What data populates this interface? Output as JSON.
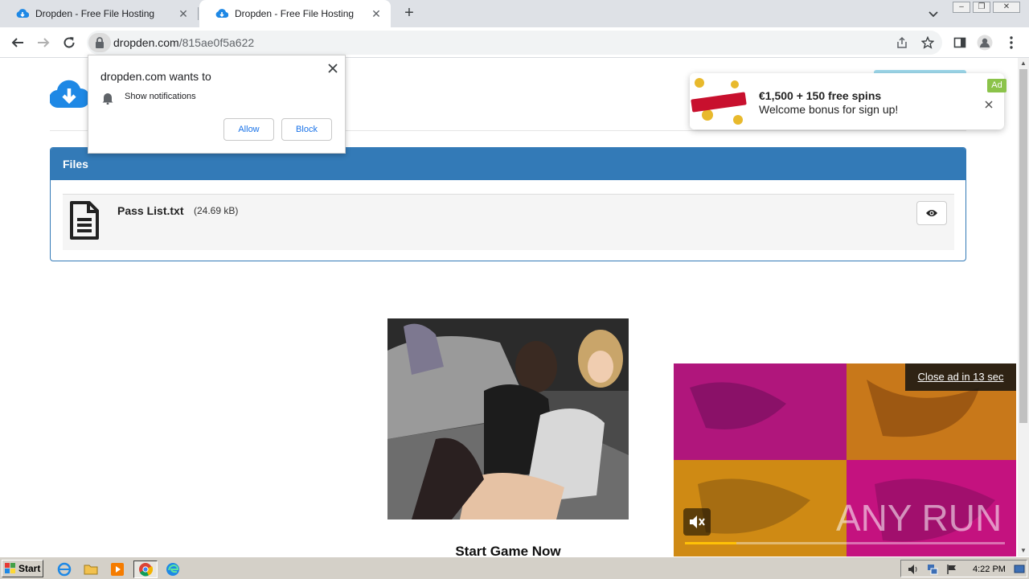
{
  "browser": {
    "tabs": [
      {
        "title": "Dropden - Free File Hosting",
        "active": false
      },
      {
        "title": "Dropden - Free File Hosting",
        "active": true
      }
    ],
    "address": {
      "domain": "dropden.com",
      "path": "/815ae0f5a622"
    }
  },
  "permission_prompt": {
    "title": "dropden.com wants to",
    "item": "Show notifications",
    "allow_label": "Allow",
    "block_label": "Block"
  },
  "ad_toast": {
    "title": "€1,500 + 150 free spins",
    "subtitle": "Welcome bonus for sign up!",
    "badge": "Ad"
  },
  "files_panel": {
    "heading": "Files",
    "files": [
      {
        "name": "Pass List.txt",
        "size": "(24.69 kB)"
      }
    ]
  },
  "game_ad": {
    "cta": "Start Game Now"
  },
  "video_ad": {
    "close_text": "Close ad in 13 sec",
    "progress": 0.16,
    "watermark": "ANY RUN"
  },
  "taskbar": {
    "start_label": "Start",
    "clock": "4:22 PM"
  },
  "colors": {
    "panel_blue": "#337ab7",
    "link_blue": "#1a73e8",
    "ad_green": "#8bc34a",
    "progress_yellow": "#ffc107"
  }
}
